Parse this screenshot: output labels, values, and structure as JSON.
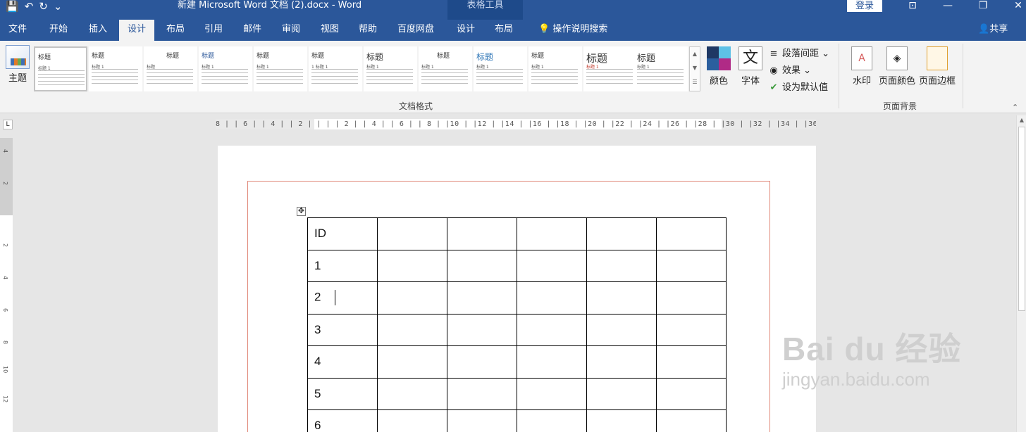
{
  "titlebar": {
    "doc_title": "新建 Microsoft Word 文档 (2).docx  -  Word",
    "context_tab": "表格工具",
    "login": "登录",
    "qat_save": "💾",
    "qat_undo": "↶",
    "qat_redo": "↻",
    "qat_more": "⌄",
    "win_ribbon_opts": "⊡",
    "win_minimize": "—",
    "win_restore": "❐",
    "win_close": "✕"
  },
  "tabs": [
    {
      "label": "文件"
    },
    {
      "label": "开始"
    },
    {
      "label": "插入"
    },
    {
      "label": "设计"
    },
    {
      "label": "布局"
    },
    {
      "label": "引用"
    },
    {
      "label": "邮件"
    },
    {
      "label": "审阅"
    },
    {
      "label": "视图"
    },
    {
      "label": "帮助"
    },
    {
      "label": "百度网盘"
    },
    {
      "label": "设计"
    },
    {
      "label": "布局"
    },
    {
      "label": "操作说明搜索"
    }
  ],
  "share": "共享",
  "ribbon": {
    "theme_label": "主题",
    "styles": [
      {
        "title": "标题",
        "heading": "标题 1"
      },
      {
        "title": "标题",
        "heading": "标题 1"
      },
      {
        "title": "标题",
        "heading": "标题"
      },
      {
        "title": "标题",
        "heading": "标题 1"
      },
      {
        "title": "标题",
        "heading": "标题 1"
      },
      {
        "title": "标题",
        "heading": "1 标题 1"
      },
      {
        "title": "标题",
        "heading": "标题 1"
      },
      {
        "title": "标题",
        "heading": "标题 1"
      },
      {
        "title": "标题",
        "heading": "标题 1"
      },
      {
        "title": "标题",
        "heading": "标题 1"
      },
      {
        "title": "标题",
        "heading": "标题 1"
      },
      {
        "title": "标题",
        "heading": "标题 1"
      }
    ],
    "doc_format_label": "文档格式",
    "colors_label": "颜色",
    "colors": [
      "#1f3864",
      "#5ec1e6",
      "#2b5f9e",
      "#b02a86"
    ],
    "fonts_label": "字体",
    "fonts_glyph": "文",
    "paragraph_spacing": "段落间距",
    "effects": "效果",
    "set_default": "设为默认值",
    "watermark": "水印",
    "page_color": "页面颜色",
    "page_borders": "页面边框",
    "page_background_label": "页面背景"
  },
  "ruler": {
    "h_marks": "8 |  | 6 |  | 4 |  | 2 |  |   |  | 2 |  | 4 |  | 6 |  | 8 |  |10 |  |12 |  |14 |  |16 |  |18 |  |20 |  |22 |  |24 |  |26 |  |28 |  |30 |  |32 |  |34 |  |36 |  |38 |  |40 |",
    "v_marks": [
      "4",
      "2",
      "2",
      "4",
      "6",
      "8",
      "10",
      "12"
    ]
  },
  "table": {
    "rows": [
      [
        "ID",
        "",
        "",
        "",
        "",
        ""
      ],
      [
        "1",
        "",
        "",
        "",
        "",
        ""
      ],
      [
        "2",
        "",
        "",
        "",
        "",
        ""
      ],
      [
        "3",
        "",
        "",
        "",
        "",
        ""
      ],
      [
        "4",
        "",
        "",
        "",
        "",
        ""
      ],
      [
        "5",
        "",
        "",
        "",
        "",
        ""
      ],
      [
        "6",
        "",
        "",
        "",
        "",
        ""
      ]
    ]
  },
  "watermark": {
    "logo": "Bai du 经验",
    "url": "jingyan.baidu.com"
  }
}
